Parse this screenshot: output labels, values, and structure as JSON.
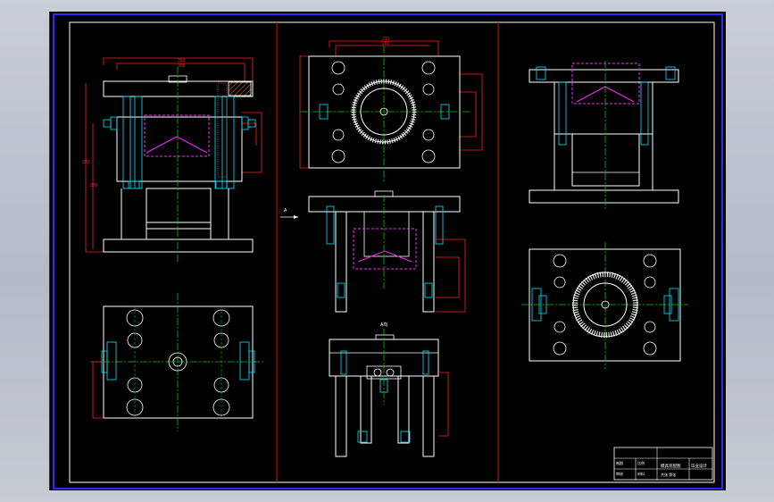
{
  "colors": {
    "background_app": "#c2c7d1",
    "canvas": "#000000",
    "border_blue": "#2b2bff",
    "border_white": "#ffffff",
    "divider_red": "#c81414",
    "outline": "#ffffff",
    "center_line": "#00c800",
    "hidden_cyan": "#00e5ff",
    "part_magenta": "#ff22ff",
    "dimension_red": "#ff2020",
    "hatch": "#a0522d"
  },
  "title_block": {
    "drawing_title": "模具装配图",
    "scale_label": "比例",
    "material_label": "材料",
    "sheet_label": "共张 第张",
    "drawer_label": "制图",
    "check_label": "审核",
    "school_label": "毕业设计"
  },
  "views": {
    "section_label": "A-A",
    "view_label": "A向",
    "arrow_label": "A"
  }
}
